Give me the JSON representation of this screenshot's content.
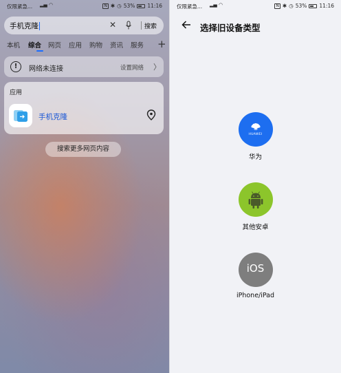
{
  "left_status": {
    "carrier": "仅限紧急...",
    "battery": "53%",
    "time": "11:16"
  },
  "right_status": {
    "carrier": "仅限紧急...",
    "battery": "53%",
    "time": "11:16"
  },
  "search": {
    "query": "手机克隆",
    "button_label": "搜索"
  },
  "tabs": [
    {
      "label": "本机"
    },
    {
      "label": "综合"
    },
    {
      "label": "网页"
    },
    {
      "label": "应用"
    },
    {
      "label": "购物"
    },
    {
      "label": "资讯"
    },
    {
      "label": "服务"
    }
  ],
  "tab_add": "+",
  "network": {
    "message": "网络未连接",
    "action": "设置网络"
  },
  "app_section": {
    "title": "应用",
    "app_name": "手机克隆"
  },
  "more_button": "搜索更多网页内容",
  "right_header": {
    "title": "选择旧设备类型"
  },
  "devices": [
    {
      "label": "华为",
      "logo_text": "HUAWEI",
      "color": "#1d6ef0"
    },
    {
      "label": "其他安卓",
      "color": "#8cc52b"
    },
    {
      "label": "iPhone/iPad",
      "logo_text": "iOS",
      "color": "#7e7e7e"
    }
  ]
}
